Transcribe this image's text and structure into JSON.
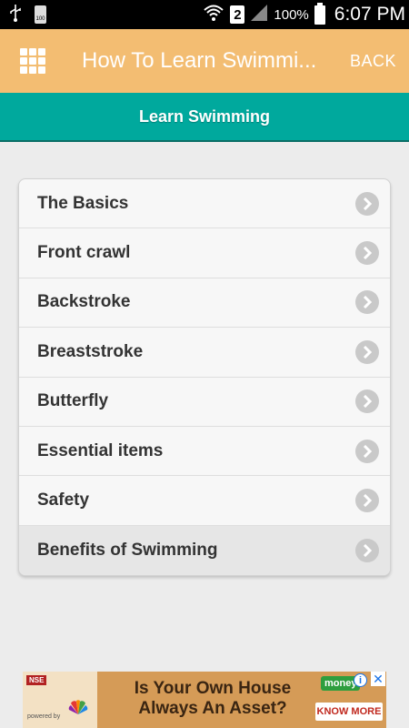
{
  "status_bar": {
    "sim_slot": "2",
    "battery_percent": "100%",
    "time": "6:07 PM",
    "battery_small_text": "100"
  },
  "app_bar": {
    "title": "How To Learn Swimmi...",
    "back_label": "BACK",
    "background_color": "#f3bd72"
  },
  "section_header": {
    "title": "Learn Swimming",
    "background_color": "#00a99d"
  },
  "menu": {
    "items": [
      {
        "label": "The Basics"
      },
      {
        "label": "Front crawl"
      },
      {
        "label": "Backstroke"
      },
      {
        "label": "Breaststroke"
      },
      {
        "label": "Butterfly"
      },
      {
        "label": "Essential items"
      },
      {
        "label": "Safety"
      },
      {
        "label": "Benefits of Swimming"
      }
    ]
  },
  "ad": {
    "headline_line1": "Is Your Own House",
    "headline_line2": "Always An Asset?",
    "cta": "KNOW MORE",
    "brand": "money",
    "source_tag": "NSE",
    "powered_by": "powered by"
  }
}
